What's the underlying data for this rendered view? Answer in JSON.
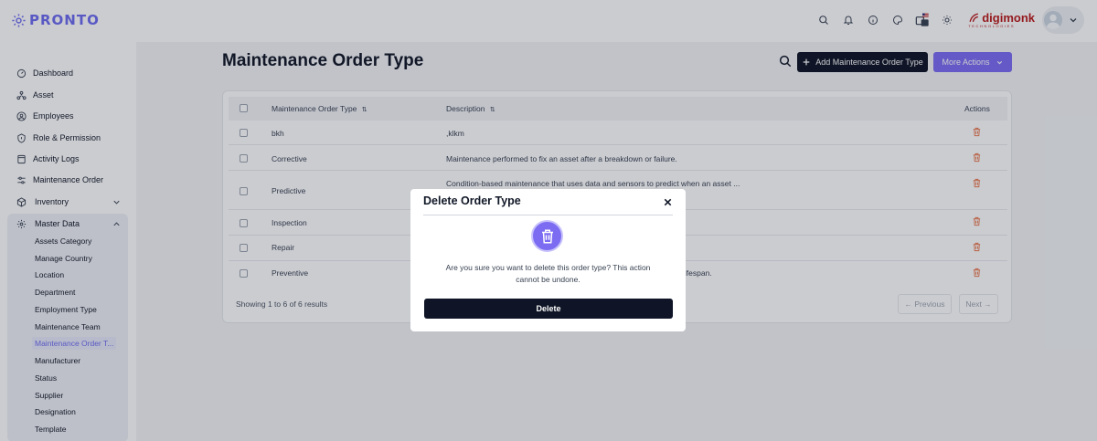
{
  "app": {
    "logo_text": "PRONTO"
  },
  "header": {
    "icons": [
      "search-icon",
      "bell-icon",
      "info-icon",
      "palette-icon",
      "translate-icon",
      "sun-icon"
    ],
    "brand_name": "digimonk",
    "brand_sub": "TECHNOLOGIES"
  },
  "sidebar": {
    "items": [
      {
        "label": "Dashboard",
        "icon": "dashboard-icon"
      },
      {
        "label": "Asset",
        "icon": "asset-icon"
      },
      {
        "label": "Employees",
        "icon": "user-icon"
      },
      {
        "label": "Role & Permission",
        "icon": "shield-icon"
      },
      {
        "label": "Activity Logs",
        "icon": "log-icon"
      },
      {
        "label": "Maintenance Order",
        "icon": "sliders-icon"
      },
      {
        "label": "Inventory",
        "icon": "cube-icon"
      },
      {
        "label": "Master Data",
        "icon": "gear-icon"
      }
    ],
    "master_sub": [
      "Assets Category",
      "Manage Country",
      "Location",
      "Department",
      "Employment Type",
      "Maintenance Team",
      "Maintenance Order T...",
      "Manufacturer",
      "Status",
      "Supplier",
      "Designation",
      "Template"
    ],
    "active_sub_index": 6
  },
  "main": {
    "title": "Maintenance Order Type",
    "add_label": "Add Maintenance Order Type",
    "more_label": "More Actions",
    "columns": [
      "Maintenance Order Type",
      "Description",
      "Actions"
    ],
    "rows": [
      {
        "type": "bkh",
        "description": ",klkm"
      },
      {
        "type": "Corrective",
        "description": "Maintenance performed to fix an asset after a breakdown or failure."
      },
      {
        "type": "Predictive",
        "description": "Condition-based maintenance that uses data and sensors to predict when an asset ..."
      },
      {
        "type": "Inspection",
        "description": ""
      },
      {
        "type": "Repair",
        "description": ""
      },
      {
        "type": "Preventive",
        "description": "lifespan."
      }
    ],
    "footer_text": "Showing 1 to 6 of 6 results",
    "prev_label": "← Previous",
    "next_label": "Next →"
  },
  "modal": {
    "title": "Delete Order Type",
    "message": "Are you sure you want to delete this order type? This action cannot be undone.",
    "delete_label": "Delete"
  },
  "colors": {
    "accent": "#7c6cf2",
    "primary_dark": "#0f1526",
    "danger": "#e8774d"
  }
}
